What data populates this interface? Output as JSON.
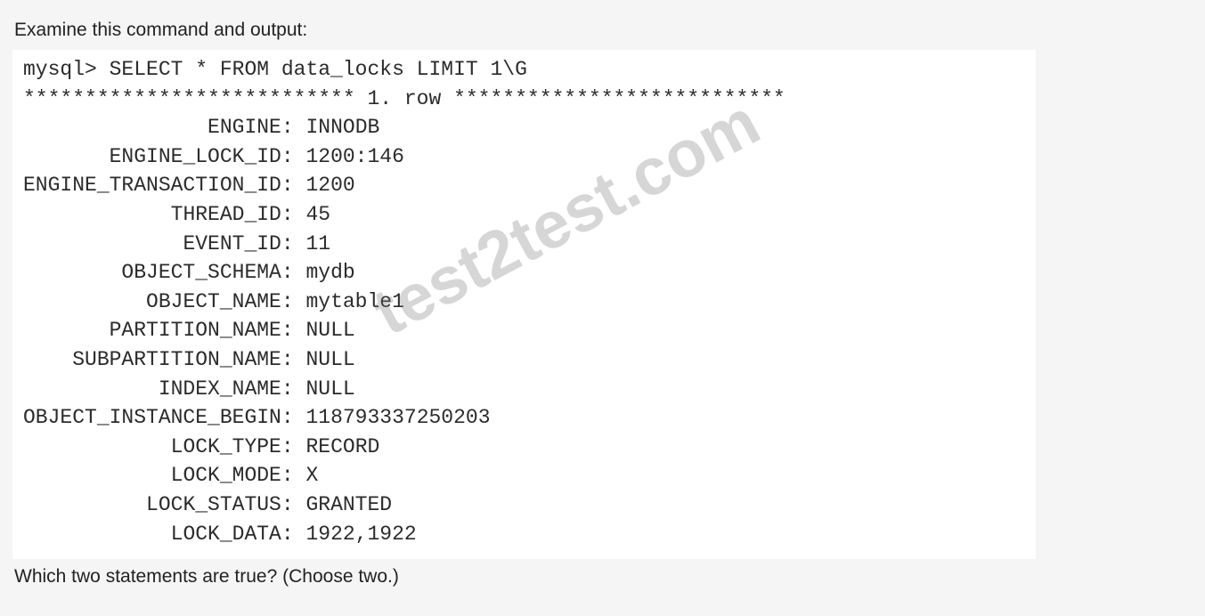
{
  "prompt": "Examine this command and output:",
  "terminal": {
    "command": "mysql> SELECT * FROM data_locks LIMIT 1\\G",
    "separator": "*************************** 1. row ***************************",
    "rows": [
      {
        "key": "ENGINE",
        "value": "INNODB"
      },
      {
        "key": "ENGINE_LOCK_ID",
        "value": "1200:146"
      },
      {
        "key": "ENGINE_TRANSACTION_ID",
        "value": "1200"
      },
      {
        "key": "THREAD_ID",
        "value": "45"
      },
      {
        "key": "EVENT_ID",
        "value": "11"
      },
      {
        "key": "OBJECT_SCHEMA",
        "value": "mydb"
      },
      {
        "key": "OBJECT_NAME",
        "value": "mytable1"
      },
      {
        "key": "PARTITION_NAME",
        "value": "NULL"
      },
      {
        "key": "SUBPARTITION_NAME",
        "value": "NULL"
      },
      {
        "key": "INDEX_NAME",
        "value": "NULL"
      },
      {
        "key": "OBJECT_INSTANCE_BEGIN",
        "value": "118793337250203"
      },
      {
        "key": "LOCK_TYPE",
        "value": "RECORD"
      },
      {
        "key": "LOCK_MODE",
        "value": "X"
      },
      {
        "key": "LOCK_STATUS",
        "value": "GRANTED"
      },
      {
        "key": "LOCK_DATA",
        "value": "1922,1922"
      }
    ]
  },
  "watermark": "test2test.com",
  "question": "Which two statements are true? (Choose two.)"
}
